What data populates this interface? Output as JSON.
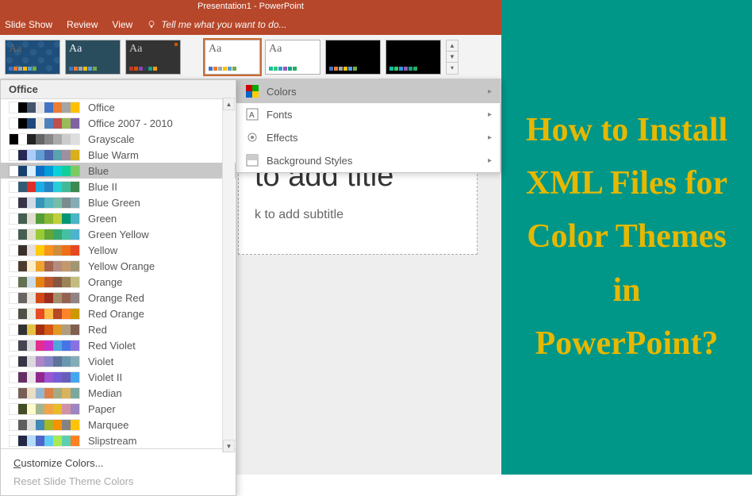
{
  "titlebar": {
    "title": "Presentation1 - PowerPoint"
  },
  "ribbon": {
    "tabs": [
      "Slide Show",
      "Review",
      "View"
    ],
    "tell_me": "Tell me what you want to do..."
  },
  "themes_gallery": {
    "items": [
      {
        "name": "pattern",
        "bg": "pattern",
        "swatches": [
          "#4472c4",
          "#ed7d31",
          "#a5a5a5",
          "#ffc000",
          "#5b9bd5",
          "#70ad47"
        ]
      },
      {
        "name": "teal",
        "bg": "blue",
        "swatches": [
          "#4472c4",
          "#ed7d31",
          "#a5a5a5",
          "#ffc000",
          "#5b9bd5",
          "#70ad47"
        ]
      },
      {
        "name": "dark-red",
        "bg": "dark",
        "swatches": [
          "#c0392b",
          "#d35400",
          "#8e44ad",
          "#2c3e50",
          "#16a085",
          "#f39c12"
        ],
        "corner": true
      },
      {
        "name": "white-1",
        "bg": "white",
        "swatches": [
          "#4472c4",
          "#ed7d31",
          "#a5a5a5",
          "#ffc000",
          "#5b9bd5",
          "#70ad47"
        ],
        "active": true
      },
      {
        "name": "white-2",
        "bg": "white",
        "swatches": [
          "#1abc9c",
          "#2ecc71",
          "#3498db",
          "#9b59b6",
          "#16a085",
          "#27ae60"
        ]
      },
      {
        "name": "black-1",
        "bg": "black",
        "swatches": [
          "#4472c4",
          "#ed7d31",
          "#a5a5a5",
          "#ffc000",
          "#5b9bd5",
          "#70ad47"
        ]
      },
      {
        "name": "black-2",
        "bg": "black",
        "swatches": [
          "#1abc9c",
          "#2ecc71",
          "#3498db",
          "#9b59b6",
          "#16a085",
          "#27ae60"
        ]
      }
    ]
  },
  "colors_panel": {
    "header": "Office",
    "schemes": [
      {
        "label": "Office",
        "swatches": [
          "#ffffff",
          "#000000",
          "#44546a",
          "#e7e6e6",
          "#4472c4",
          "#ed7d31",
          "#a5a5a5",
          "#ffc000"
        ]
      },
      {
        "label": "Office 2007 - 2010",
        "swatches": [
          "#ffffff",
          "#000000",
          "#1f497d",
          "#eeece1",
          "#4f81bd",
          "#c0504d",
          "#9bbb59",
          "#8064a2"
        ]
      },
      {
        "label": "Grayscale",
        "swatches": [
          "#000000",
          "#ffffff",
          "#222222",
          "#666666",
          "#888888",
          "#aaaaaa",
          "#cccccc",
          "#dddddd"
        ]
      },
      {
        "label": "Blue Warm",
        "swatches": [
          "#ffffff",
          "#242852",
          "#accbf9",
          "#629dd1",
          "#4a66ac",
          "#5aa2ae",
          "#9d90a0",
          "#d9b01c"
        ]
      },
      {
        "label": "Blue",
        "swatches": [
          "#ffffff",
          "#17406d",
          "#dbefff",
          "#0f6fc6",
          "#009dd9",
          "#0bd0d9",
          "#10cf9b",
          "#7cca62"
        ],
        "selected": true
      },
      {
        "label": "Blue II",
        "swatches": [
          "#ffffff",
          "#335b74",
          "#df2e28",
          "#1cade4",
          "#2683c6",
          "#27ced7",
          "#42ba97",
          "#3e8853"
        ]
      },
      {
        "label": "Blue Green",
        "swatches": [
          "#ffffff",
          "#373545",
          "#cedbe6",
          "#3494ba",
          "#58b6c0",
          "#75bda7",
          "#7a8c8e",
          "#84acb6"
        ]
      },
      {
        "label": "Green",
        "swatches": [
          "#ffffff",
          "#455f51",
          "#e3ded1",
          "#549e39",
          "#8ab833",
          "#c0cf3a",
          "#029676",
          "#4ab5c4"
        ]
      },
      {
        "label": "Green Yellow",
        "swatches": [
          "#ffffff",
          "#455f51",
          "#e2dfcc",
          "#99cb38",
          "#63a537",
          "#37a76f",
          "#44c1a3",
          "#4eb3cf"
        ]
      },
      {
        "label": "Yellow",
        "swatches": [
          "#ffffff",
          "#39302a",
          "#e5dedb",
          "#ffca08",
          "#f8931d",
          "#ce8d3e",
          "#ec7016",
          "#e64823"
        ]
      },
      {
        "label": "Yellow Orange",
        "swatches": [
          "#ffffff",
          "#4e3b30",
          "#fbeec9",
          "#f0a22e",
          "#a5644e",
          "#b58b80",
          "#c3986d",
          "#a19574"
        ]
      },
      {
        "label": "Orange",
        "swatches": [
          "#ffffff",
          "#637052",
          "#ccddea",
          "#e48312",
          "#bd582c",
          "#865640",
          "#9b8357",
          "#c2bc80"
        ]
      },
      {
        "label": "Orange Red",
        "swatches": [
          "#ffffff",
          "#696464",
          "#e9e5dc",
          "#d34817",
          "#9b2d1f",
          "#a28e6a",
          "#956251",
          "#918485"
        ]
      },
      {
        "label": "Red Orange",
        "swatches": [
          "#ffffff",
          "#505046",
          "#eeece1",
          "#e84c22",
          "#ffbd47",
          "#b64926",
          "#ff8427",
          "#cc9900"
        ]
      },
      {
        "label": "Red",
        "swatches": [
          "#ffffff",
          "#323232",
          "#e5c243",
          "#a5300f",
          "#d55816",
          "#e19825",
          "#b19c7d",
          "#7f5f52"
        ]
      },
      {
        "label": "Red Violet",
        "swatches": [
          "#ffffff",
          "#454551",
          "#d8d9dc",
          "#e32d91",
          "#c830cc",
          "#4ea6dc",
          "#4775e7",
          "#8971e1"
        ]
      },
      {
        "label": "Violet",
        "swatches": [
          "#ffffff",
          "#373545",
          "#dcd8dc",
          "#ad84c6",
          "#8784c7",
          "#5d739a",
          "#6997af",
          "#84acb6"
        ]
      },
      {
        "label": "Violet II",
        "swatches": [
          "#ffffff",
          "#632e62",
          "#eae5eb",
          "#92278f",
          "#9b57d3",
          "#755dd9",
          "#665eb8",
          "#45a5ed"
        ]
      },
      {
        "label": "Median",
        "swatches": [
          "#ffffff",
          "#775f55",
          "#ebddc3",
          "#94b6d2",
          "#dd8047",
          "#a5ab81",
          "#d8b25c",
          "#7ba79d"
        ]
      },
      {
        "label": "Paper",
        "swatches": [
          "#ffffff",
          "#444d26",
          "#fefac9",
          "#a5b592",
          "#f3a447",
          "#e7bc29",
          "#d092a7",
          "#9c85c0"
        ]
      },
      {
        "label": "Marquee",
        "swatches": [
          "#ffffff",
          "#5e5e5e",
          "#dddddd",
          "#418ab3",
          "#a6b727",
          "#f69200",
          "#838383",
          "#fec306"
        ]
      },
      {
        "label": "Slipstream",
        "swatches": [
          "#ffffff",
          "#212745",
          "#b4dcfa",
          "#4e67c8",
          "#5eccf3",
          "#a7ea52",
          "#5dceaf",
          "#ff8021"
        ]
      }
    ],
    "footer": {
      "customize": "Customize Colors...",
      "reset": "Reset Slide Theme Colors"
    }
  },
  "variant_panel": {
    "items": [
      {
        "label": "Colors",
        "icon": "colors",
        "active": true
      },
      {
        "label": "Fonts",
        "icon": "fonts"
      },
      {
        "label": "Effects",
        "icon": "effects"
      },
      {
        "label": "Background Styles",
        "icon": "background"
      }
    ]
  },
  "slide": {
    "title_placeholder": "to add title",
    "subtitle_placeholder": "k to add subtitle"
  },
  "right_panel": {
    "text": "How to Install XML Files for Color Themes in PowerPoint?"
  }
}
